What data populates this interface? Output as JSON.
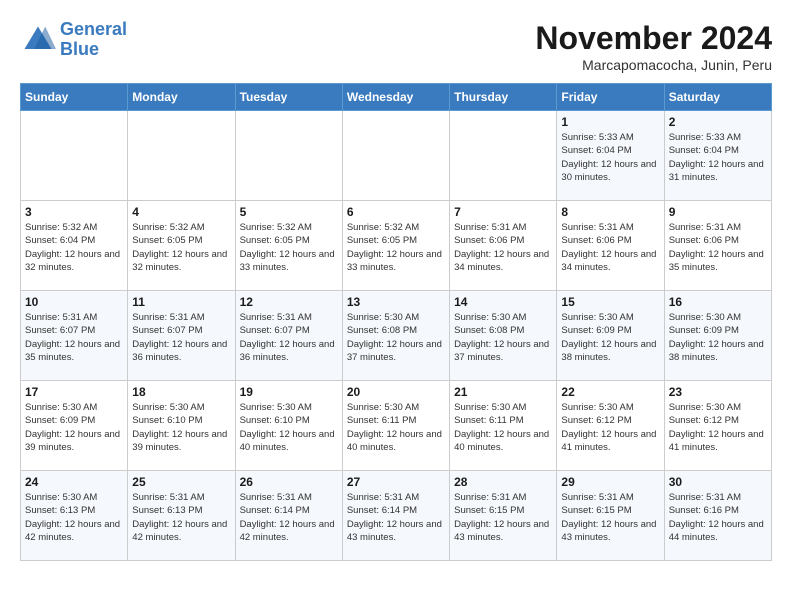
{
  "logo": {
    "line1": "General",
    "line2": "Blue"
  },
  "title": "November 2024",
  "subtitle": "Marcapomacocha, Junin, Peru",
  "days_of_week": [
    "Sunday",
    "Monday",
    "Tuesday",
    "Wednesday",
    "Thursday",
    "Friday",
    "Saturday"
  ],
  "weeks": [
    [
      {
        "day": "",
        "info": ""
      },
      {
        "day": "",
        "info": ""
      },
      {
        "day": "",
        "info": ""
      },
      {
        "day": "",
        "info": ""
      },
      {
        "day": "",
        "info": ""
      },
      {
        "day": "1",
        "info": "Sunrise: 5:33 AM\nSunset: 6:04 PM\nDaylight: 12 hours and 30 minutes."
      },
      {
        "day": "2",
        "info": "Sunrise: 5:33 AM\nSunset: 6:04 PM\nDaylight: 12 hours and 31 minutes."
      }
    ],
    [
      {
        "day": "3",
        "info": "Sunrise: 5:32 AM\nSunset: 6:04 PM\nDaylight: 12 hours and 32 minutes."
      },
      {
        "day": "4",
        "info": "Sunrise: 5:32 AM\nSunset: 6:05 PM\nDaylight: 12 hours and 32 minutes."
      },
      {
        "day": "5",
        "info": "Sunrise: 5:32 AM\nSunset: 6:05 PM\nDaylight: 12 hours and 33 minutes."
      },
      {
        "day": "6",
        "info": "Sunrise: 5:32 AM\nSunset: 6:05 PM\nDaylight: 12 hours and 33 minutes."
      },
      {
        "day": "7",
        "info": "Sunrise: 5:31 AM\nSunset: 6:06 PM\nDaylight: 12 hours and 34 minutes."
      },
      {
        "day": "8",
        "info": "Sunrise: 5:31 AM\nSunset: 6:06 PM\nDaylight: 12 hours and 34 minutes."
      },
      {
        "day": "9",
        "info": "Sunrise: 5:31 AM\nSunset: 6:06 PM\nDaylight: 12 hours and 35 minutes."
      }
    ],
    [
      {
        "day": "10",
        "info": "Sunrise: 5:31 AM\nSunset: 6:07 PM\nDaylight: 12 hours and 35 minutes."
      },
      {
        "day": "11",
        "info": "Sunrise: 5:31 AM\nSunset: 6:07 PM\nDaylight: 12 hours and 36 minutes."
      },
      {
        "day": "12",
        "info": "Sunrise: 5:31 AM\nSunset: 6:07 PM\nDaylight: 12 hours and 36 minutes."
      },
      {
        "day": "13",
        "info": "Sunrise: 5:30 AM\nSunset: 6:08 PM\nDaylight: 12 hours and 37 minutes."
      },
      {
        "day": "14",
        "info": "Sunrise: 5:30 AM\nSunset: 6:08 PM\nDaylight: 12 hours and 37 minutes."
      },
      {
        "day": "15",
        "info": "Sunrise: 5:30 AM\nSunset: 6:09 PM\nDaylight: 12 hours and 38 minutes."
      },
      {
        "day": "16",
        "info": "Sunrise: 5:30 AM\nSunset: 6:09 PM\nDaylight: 12 hours and 38 minutes."
      }
    ],
    [
      {
        "day": "17",
        "info": "Sunrise: 5:30 AM\nSunset: 6:09 PM\nDaylight: 12 hours and 39 minutes."
      },
      {
        "day": "18",
        "info": "Sunrise: 5:30 AM\nSunset: 6:10 PM\nDaylight: 12 hours and 39 minutes."
      },
      {
        "day": "19",
        "info": "Sunrise: 5:30 AM\nSunset: 6:10 PM\nDaylight: 12 hours and 40 minutes."
      },
      {
        "day": "20",
        "info": "Sunrise: 5:30 AM\nSunset: 6:11 PM\nDaylight: 12 hours and 40 minutes."
      },
      {
        "day": "21",
        "info": "Sunrise: 5:30 AM\nSunset: 6:11 PM\nDaylight: 12 hours and 40 minutes."
      },
      {
        "day": "22",
        "info": "Sunrise: 5:30 AM\nSunset: 6:12 PM\nDaylight: 12 hours and 41 minutes."
      },
      {
        "day": "23",
        "info": "Sunrise: 5:30 AM\nSunset: 6:12 PM\nDaylight: 12 hours and 41 minutes."
      }
    ],
    [
      {
        "day": "24",
        "info": "Sunrise: 5:30 AM\nSunset: 6:13 PM\nDaylight: 12 hours and 42 minutes."
      },
      {
        "day": "25",
        "info": "Sunrise: 5:31 AM\nSunset: 6:13 PM\nDaylight: 12 hours and 42 minutes."
      },
      {
        "day": "26",
        "info": "Sunrise: 5:31 AM\nSunset: 6:14 PM\nDaylight: 12 hours and 42 minutes."
      },
      {
        "day": "27",
        "info": "Sunrise: 5:31 AM\nSunset: 6:14 PM\nDaylight: 12 hours and 43 minutes."
      },
      {
        "day": "28",
        "info": "Sunrise: 5:31 AM\nSunset: 6:15 PM\nDaylight: 12 hours and 43 minutes."
      },
      {
        "day": "29",
        "info": "Sunrise: 5:31 AM\nSunset: 6:15 PM\nDaylight: 12 hours and 43 minutes."
      },
      {
        "day": "30",
        "info": "Sunrise: 5:31 AM\nSunset: 6:16 PM\nDaylight: 12 hours and 44 minutes."
      }
    ]
  ]
}
